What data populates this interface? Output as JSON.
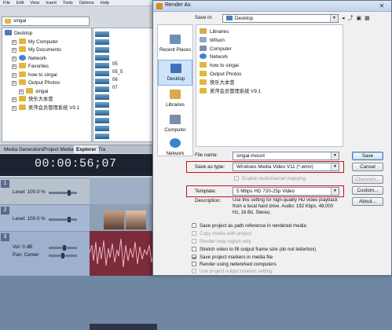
{
  "vegas": {
    "menu": [
      "File",
      "Edit",
      "View",
      "Insert",
      "Tools",
      "Options",
      "Help"
    ],
    "explorer_path": "singai",
    "tree": [
      {
        "label": "Desktop",
        "indent": 0,
        "icon": "blue"
      },
      {
        "label": "My Computer",
        "indent": 1,
        "icon": "folder"
      },
      {
        "label": "My Documents",
        "indent": 1,
        "icon": "folder"
      },
      {
        "label": "Network",
        "indent": 1,
        "icon": "globe"
      },
      {
        "label": "Favorites",
        "indent": 1,
        "icon": "folder"
      },
      {
        "label": "how to singai",
        "indent": 1,
        "icon": "folder"
      },
      {
        "label": "Output Photos",
        "indent": 1,
        "icon": "folder"
      },
      {
        "label": "singai",
        "indent": 2,
        "icon": "folder"
      },
      {
        "label": "快乐大本营",
        "indent": 1,
        "icon": "folder"
      },
      {
        "label": "美萍会员管理系统 V9.1",
        "indent": 1,
        "icon": "folder"
      }
    ],
    "file_list": [
      "05",
      "05_5",
      "06",
      "07"
    ],
    "tabs": [
      "Media Generators",
      "Project Media",
      "Explorer",
      "Tra"
    ],
    "active_tab": "Explorer",
    "timecode": "00:00:56;07",
    "track1": {
      "number": "1",
      "level_label": "Level:",
      "level_value": "100.0 %"
    },
    "track2": {
      "number": "2",
      "level_label": "Level:",
      "level_value": "100.0 %"
    },
    "track3": {
      "number": "3",
      "vol_label": "Vol:",
      "vol_value": "0 dB",
      "pan_label": "Pan:",
      "pan_value": "Center"
    }
  },
  "dialog": {
    "title": "Render As",
    "close_icon": "close-icon",
    "save_in_label": "Save in:",
    "save_in_value": "Desktop",
    "places": [
      "Recent Places",
      "Desktop",
      "Libraries",
      "Computer",
      "Network"
    ],
    "selected_place": "Desktop",
    "files": [
      {
        "name": "Libraries",
        "icon": "library"
      },
      {
        "name": "Wilson",
        "icon": "user"
      },
      {
        "name": "Computer",
        "icon": "computer"
      },
      {
        "name": "Network",
        "icon": "network"
      },
      {
        "name": "how to singai",
        "icon": "folder"
      },
      {
        "name": "Output Photos",
        "icon": "folder"
      },
      {
        "name": "快乐大本营",
        "icon": "folder"
      },
      {
        "name": "美萍会员管理系统 V9.1",
        "icon": "folder"
      }
    ],
    "file_name_label": "File name:",
    "file_name_value": "singai-mount",
    "save_as_type_label": "Save as type:",
    "save_as_type_value": "Windows Media Video V11 (*.wmv)",
    "multichannel_label": "Enable multichannel mapping",
    "template_label": "Template:",
    "template_value": "5 Mbps HD 720-25p Video",
    "description_label": "Description:",
    "description_text": "Use this setting for high-quality HD video playback from a local hard drive. Audio: 192 Kbps, 48,000 Hz, 16 Bit, Stereo,",
    "buttons": {
      "save": "Save",
      "cancel": "Cancel",
      "channels": "Channels...",
      "custom": "Custom...",
      "about": "About..."
    },
    "options": [
      {
        "label": "Save project as path reference in rendered media",
        "checked": false,
        "enabled": true
      },
      {
        "label": "Copy media with project",
        "checked": false,
        "enabled": false
      },
      {
        "label": "Render loop region only",
        "checked": false,
        "enabled": false
      },
      {
        "label": "Stretch video to fill output frame size (do not letterbox)",
        "checked": false,
        "enabled": true
      },
      {
        "label": "Save project markers in media file",
        "checked": true,
        "enabled": true
      },
      {
        "label": "Render using networked computers",
        "checked": false,
        "enabled": true
      },
      {
        "label": "Use project output rotation setting",
        "checked": false,
        "enabled": false
      }
    ],
    "highlight_color": "#c4121f"
  }
}
